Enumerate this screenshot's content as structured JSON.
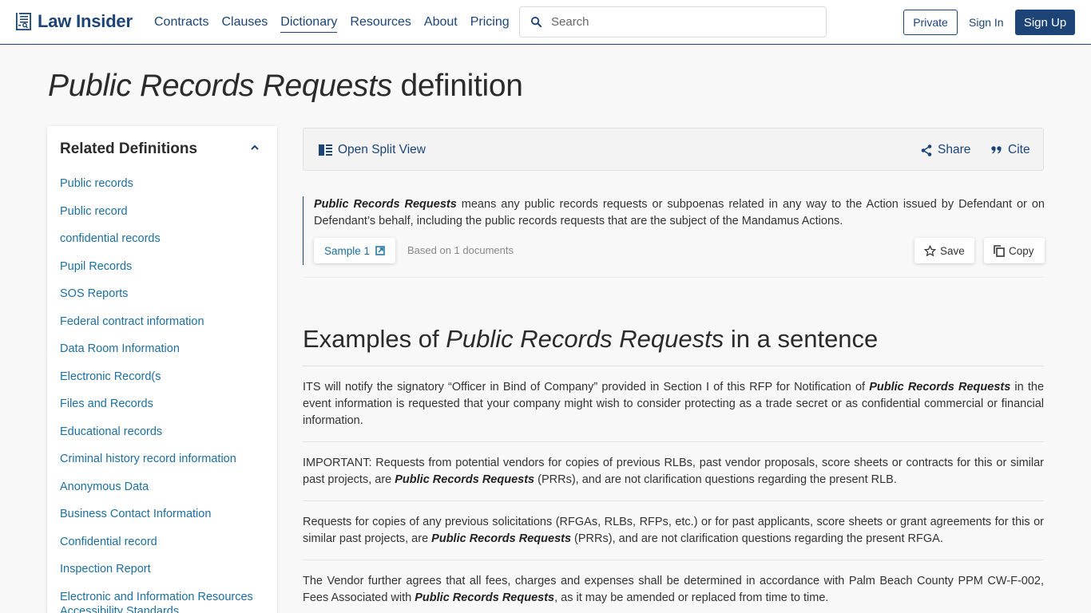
{
  "header": {
    "brand": "Law Insider",
    "nav": [
      {
        "label": "Contracts",
        "active": false
      },
      {
        "label": "Clauses",
        "active": false
      },
      {
        "label": "Dictionary",
        "active": true
      },
      {
        "label": "Resources",
        "active": false
      },
      {
        "label": "About",
        "active": false
      },
      {
        "label": "Pricing",
        "active": false
      }
    ],
    "search_placeholder": "Search",
    "search_value": "",
    "private_label": "Private",
    "signin_label": "Sign In",
    "signup_label": "Sign Up"
  },
  "page": {
    "title_term": "Public Records Requests",
    "title_suffix": " definition"
  },
  "sidebar": {
    "heading": "Related Definitions",
    "toggle_icon": "chevron-up-icon",
    "items": [
      "Public records",
      "Public record",
      "confidential records",
      "Pupil Records",
      "SOS Reports",
      "Federal contract information",
      "Data Room Information",
      "Electronic Record(s",
      "Files and Records",
      "Educational records",
      "Criminal history record information",
      "Anonymous Data",
      "Business Contact Information",
      "Confidential record",
      "Inspection Report",
      "Electronic and Information Resources Accessibility Standards"
    ]
  },
  "toolbar": {
    "split_view_label": "Open Split View",
    "share_label": "Share",
    "cite_label": "Cite"
  },
  "definition": {
    "term": "Public Records Requests",
    "text": " means any public records requests or subpoenas related in any way to the Action issued by Defendant or on Defendant’s behalf, including the public records requests that are the subject of the Mandamus Actions.",
    "sample_label": "Sample 1",
    "based_on": "Based on 1 documents",
    "save_label": "Save",
    "copy_label": "Copy"
  },
  "examples": {
    "title_prefix": "Examples of ",
    "title_term": "Public Records Requests",
    "title_suffix": " in a sentence",
    "items": [
      {
        "before": "ITS will notify the signatory “Officer in Bind of Company” provided in Section I of this RFP for Notification of ",
        "term": "Public Records Requests",
        "after": " in the event information is requested that your company might wish to consider protecting as a trade secret or as confidential commercial or financial information."
      },
      {
        "before": "IMPORTANT: Requests from potential vendors for copies of previous RLBs, past vendor proposals, score sheets or contracts for this or similar past projects, are ",
        "term": "Public Records Requests",
        "after": " (PRRs), and are not clarification questions regarding the present RLB."
      },
      {
        "before": "Requests for copies of any previous solicitations (RFGAs, RLBs, RFPs, etc.) or for past applicants, score sheets or grant agreements for this or similar past projects, are ",
        "term": "Public Records Requests",
        "after": " (PRRs), and are not clarification questions regarding the present RFGA."
      },
      {
        "before": "The Vendor further agrees that all fees, charges and expenses shall be determined in accordance with Palm Beach County PPM CW-F-002, Fees Associated with ",
        "term": "Public Records Requests",
        "after": ", as it may be amended or replaced from time to time."
      }
    ]
  },
  "colors": {
    "brand": "#1c4476",
    "link": "#1d6fa0",
    "toolbar_bg": "#f3f3f3"
  }
}
